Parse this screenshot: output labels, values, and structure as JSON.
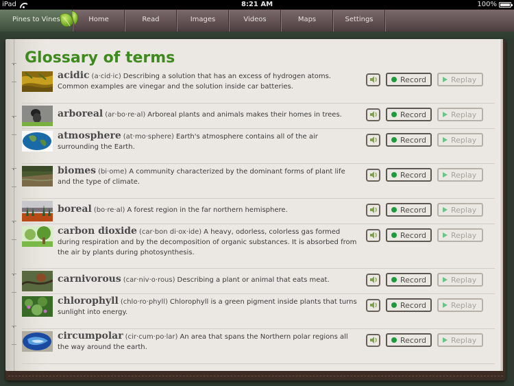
{
  "status_bar": {
    "device": "iPad",
    "time": "8:21 AM",
    "battery": "100%"
  },
  "nav": {
    "brand": "Pines to Vines",
    "tabs": [
      "Home",
      "Read",
      "Images",
      "Videos",
      "Maps",
      "Settings"
    ]
  },
  "page": {
    "title": "Glossary of terms",
    "button_labels": {
      "record": "Record",
      "replay": "Replay"
    }
  },
  "colors": {
    "title_green": "#3e8a1e",
    "record_dot": "#1f9a3e",
    "replay_play": "#6cc38a"
  },
  "entries": [
    {
      "term": "acidic",
      "pronunciation": "(a·cid·ic)",
      "definition": "Describing a solution that has an excess of hydrogen atoms. Common examples are vinegar and the solution inside car batteries.",
      "thumbnail": "moss-texture-image"
    },
    {
      "term": "arboreal",
      "pronunciation": "(ar·bo·re·al)",
      "definition": "Arboreal plants and animals makes their homes in trees.",
      "thumbnail": "tree-animal-image"
    },
    {
      "term": "atmosphere",
      "pronunciation": "(at·mo·sphere)",
      "definition": "Earth's atmosphere contains all of the air surrounding the Earth.",
      "thumbnail": "earth-globe-image"
    },
    {
      "term": "biomes",
      "pronunciation": "(bi·ome)",
      "definition": "A community characterized by the dominant forms of plant life and the type of climate.",
      "thumbnail": "forest-landscape-image"
    },
    {
      "term": "boreal",
      "pronunciation": "(bo·re·al)",
      "definition": "A forest region in the far northern hemisphere.",
      "thumbnail": "boreal-forest-image"
    },
    {
      "term": "carbon dioxide",
      "pronunciation": "(car·bon di·ox·ide)",
      "definition": "A heavy, odorless, colorless gas formed during respiration and by the decomposition of organic substances. It is absorbed from the air by plants during photosynthesis.",
      "thumbnail": "tree-diagram-image"
    },
    {
      "term": "carnivorous",
      "pronunciation": "(car·niv·o·rous)",
      "definition": "Describing a plant or animal that eats meat.",
      "thumbnail": "animal-in-branches-image"
    },
    {
      "term": "chlorophyll",
      "pronunciation": "(chlo·ro·phyll)",
      "definition": "Chlorophyll is a green pigment inside plants that turns sunlight into energy.",
      "thumbnail": "green-plant-flowers-image"
    },
    {
      "term": "circumpolar",
      "pronunciation": "(cir·cum·po·lar)",
      "definition": "An area that spans the Northern polar regions all the way around the earth.",
      "thumbnail": "polar-map-image"
    }
  ]
}
